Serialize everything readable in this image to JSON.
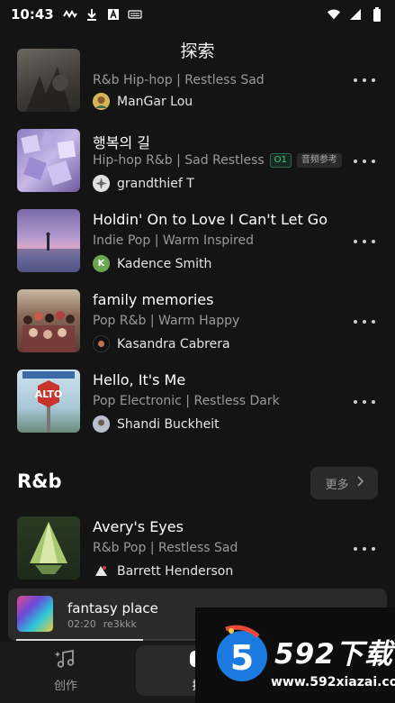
{
  "status_bar": {
    "time": "10:43"
  },
  "header": {
    "title": "探索"
  },
  "songs": [
    {
      "title": "",
      "genre": "R&b Hip-hop | Restless Sad",
      "author": "ManGar Lou"
    },
    {
      "title": "행복의 길",
      "genre": "Hip-hop R&b | Sad Restless",
      "badge_version": "O1",
      "badge_ref": "音频参考",
      "author": "grandthief T"
    },
    {
      "title": "Holdin' On to Love I Can't Let Go",
      "genre": "Indie Pop | Warm Inspired",
      "author": "Kadence Smith",
      "avatar_letter": "K"
    },
    {
      "title": "family memories",
      "genre": "Pop R&b | Warm Happy",
      "author": "Kasandra Cabrera"
    },
    {
      "title": "Hello, It's Me",
      "genre": "Pop Electronic | Restless Dark",
      "author": "Shandi Buckheit"
    },
    {
      "title": "Avery's Eyes",
      "genre": "R&b Pop | Restless Sad",
      "author": "Barrett Henderson"
    }
  ],
  "section": {
    "title": "R&b",
    "more_label": "更多"
  },
  "mini_player": {
    "title": "fantasy place",
    "time": "02:20",
    "author": "re3kkk",
    "progress": 0.35
  },
  "tabs": [
    {
      "label": "创作"
    },
    {
      "label": "探"
    }
  ],
  "watermark": {
    "brand": "592下载",
    "url": "www.592xiazai.com"
  }
}
